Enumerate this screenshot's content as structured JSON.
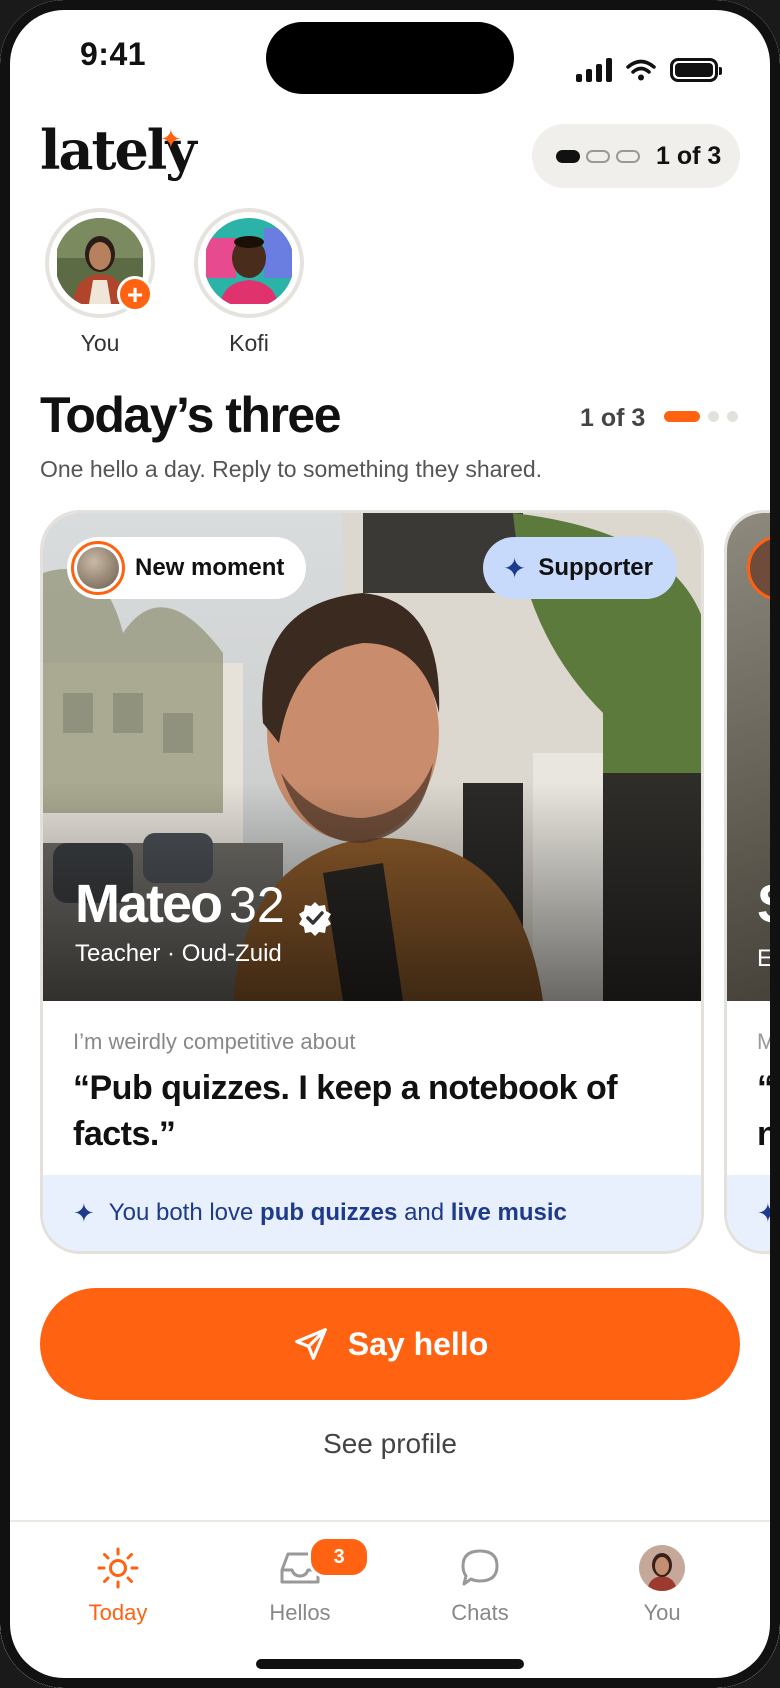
{
  "status": {
    "time": "9:41"
  },
  "header": {
    "logo": "lately",
    "progress_text": "1 of 3"
  },
  "stories": [
    {
      "name": "You"
    },
    {
      "name": "Kofi"
    }
  ],
  "section": {
    "title": "Today’s three",
    "count": "1 of 3",
    "subtitle": "One hello a day. Reply to something they shared."
  },
  "card": {
    "moment_label": "New moment",
    "supporter_label": "Supporter",
    "name": "Mateo",
    "age": "32",
    "meta": "Teacher · Oud-Zuid",
    "prompt_question": "I’m weirdly competitive about",
    "prompt_answer": "“Pub quizzes. I keep a notebook of facts.”",
    "common_prefix": "You both love",
    "common_item1": "pub quizzes",
    "common_and": "and",
    "common_item2": "live music"
  },
  "next_card": {
    "name_fragment": "S",
    "meta_fragment": "Er",
    "question_fragment": "My",
    "answer_fragment_1": "“L",
    "answer_fragment_2": "na"
  },
  "actions": {
    "say_hello": "Say hello",
    "see_profile": "See profile"
  },
  "tabs": [
    {
      "label": "Today",
      "icon": "sun-icon",
      "active": true
    },
    {
      "label": "Hellos",
      "icon": "inbox-icon",
      "badge": "3"
    },
    {
      "label": "Chats",
      "icon": "chat-bubble-icon"
    },
    {
      "label": "You",
      "icon": "avatar"
    }
  ],
  "colors": {
    "accent": "#ff6210",
    "supporter_bg": "#c7dafc",
    "common_bg": "#e8f0fd",
    "common_text": "#1e3a8a"
  }
}
